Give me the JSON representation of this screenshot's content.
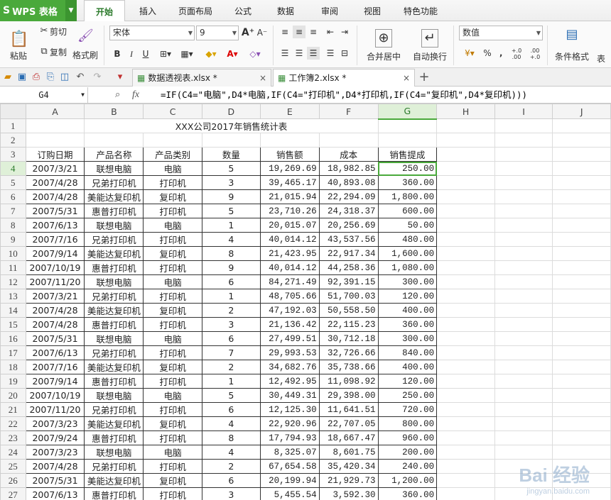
{
  "app": {
    "name": "WPS 表格"
  },
  "menu_tabs": [
    "开始",
    "插入",
    "页面布局",
    "公式",
    "数据",
    "审阅",
    "视图",
    "特色功能"
  ],
  "ribbon": {
    "paste": "粘贴",
    "cut": "剪切",
    "copy": "复制",
    "format_painter": "格式刷",
    "font_name": "宋体",
    "font_size": "9",
    "merge_center": "合并居中",
    "wrap_text": "自动换行",
    "number_format": "数值",
    "percent": "%",
    "comma": "‚",
    "inc_decimal": "+.0 .00",
    "dec_decimal": ".00 +.0",
    "cond_format": "条件格式",
    "table_style": "表"
  },
  "file_tabs": [
    {
      "name": "数据透视表.xlsx *",
      "active": false
    },
    {
      "name": "工作簿2.xlsx *",
      "active": true
    }
  ],
  "formula_bar": {
    "cell_ref": "G4",
    "fx": "fx",
    "formula": "=IF(C4=\"电脑\",D4*电脑,IF(C4=\"打印机\",D4*打印机,IF(C4=\"复印机\",D4*复印机)))"
  },
  "columns": [
    "A",
    "B",
    "C",
    "D",
    "E",
    "F",
    "G",
    "H",
    "I",
    "J"
  ],
  "sheet": {
    "title": "XXX公司2017年销售统计表",
    "headers": [
      "订购日期",
      "产品名称",
      "产品类别",
      "数量",
      "销售额",
      "成本",
      "销售提成"
    ],
    "rows": [
      [
        "2007/3/21",
        "联想电脑",
        "电脑",
        "5",
        "19,269.69",
        "18,982.85",
        "250.00"
      ],
      [
        "2007/4/28",
        "兄弟打印机",
        "打印机",
        "3",
        "39,465.17",
        "40,893.08",
        "360.00"
      ],
      [
        "2007/4/28",
        "美能达复印机",
        "复印机",
        "9",
        "21,015.94",
        "22,294.09",
        "1,800.00"
      ],
      [
        "2007/5/31",
        "惠普打印机",
        "打印机",
        "5",
        "23,710.26",
        "24,318.37",
        "600.00"
      ],
      [
        "2007/6/13",
        "联想电脑",
        "电脑",
        "1",
        "20,015.07",
        "20,256.69",
        "50.00"
      ],
      [
        "2007/7/16",
        "兄弟打印机",
        "打印机",
        "4",
        "40,014.12",
        "43,537.56",
        "480.00"
      ],
      [
        "2007/9/14",
        "美能达复印机",
        "复印机",
        "8",
        "21,423.95",
        "22,917.34",
        "1,600.00"
      ],
      [
        "2007/10/19",
        "惠普打印机",
        "打印机",
        "9",
        "40,014.12",
        "44,258.36",
        "1,080.00"
      ],
      [
        "2007/11/20",
        "联想电脑",
        "电脑",
        "6",
        "84,271.49",
        "92,391.15",
        "300.00"
      ],
      [
        "2007/3/21",
        "兄弟打印机",
        "打印机",
        "1",
        "48,705.66",
        "51,700.03",
        "120.00"
      ],
      [
        "2007/4/28",
        "美能达复印机",
        "复印机",
        "2",
        "47,192.03",
        "50,558.50",
        "400.00"
      ],
      [
        "2007/4/28",
        "惠普打印机",
        "打印机",
        "3",
        "21,136.42",
        "22,115.23",
        "360.00"
      ],
      [
        "2007/5/31",
        "联想电脑",
        "电脑",
        "6",
        "27,499.51",
        "30,712.18",
        "300.00"
      ],
      [
        "2007/6/13",
        "兄弟打印机",
        "打印机",
        "7",
        "29,993.53",
        "32,726.66",
        "840.00"
      ],
      [
        "2007/7/16",
        "美能达复印机",
        "复印机",
        "2",
        "34,682.76",
        "35,738.66",
        "400.00"
      ],
      [
        "2007/9/14",
        "惠普打印机",
        "打印机",
        "1",
        "12,492.95",
        "11,098.92",
        "120.00"
      ],
      [
        "2007/10/19",
        "联想电脑",
        "电脑",
        "5",
        "30,449.31",
        "29,398.00",
        "250.00"
      ],
      [
        "2007/11/20",
        "兄弟打印机",
        "打印机",
        "6",
        "12,125.30",
        "11,641.51",
        "720.00"
      ],
      [
        "2007/3/23",
        "美能达复印机",
        "复印机",
        "4",
        "22,920.96",
        "22,707.05",
        "800.00"
      ],
      [
        "2007/9/24",
        "惠普打印机",
        "打印机",
        "8",
        "17,794.93",
        "18,667.47",
        "960.00"
      ],
      [
        "2007/3/23",
        "联想电脑",
        "电脑",
        "4",
        "8,325.07",
        "8,601.75",
        "200.00"
      ],
      [
        "2007/4/28",
        "兄弟打印机",
        "打印机",
        "2",
        "67,654.58",
        "35,420.34",
        "240.00"
      ],
      [
        "2007/5/31",
        "美能达复印机",
        "复印机",
        "6",
        "20,199.94",
        "21,929.73",
        "1,200.00"
      ],
      [
        "2007/6/13",
        "惠普打印机",
        "打印机",
        "3",
        "5,455.54",
        "3,592.30",
        "360.00"
      ]
    ]
  },
  "selected_cell": "G4",
  "watermark": {
    "main": "Bai 经验",
    "sub": "jingyan.baidu.com"
  }
}
